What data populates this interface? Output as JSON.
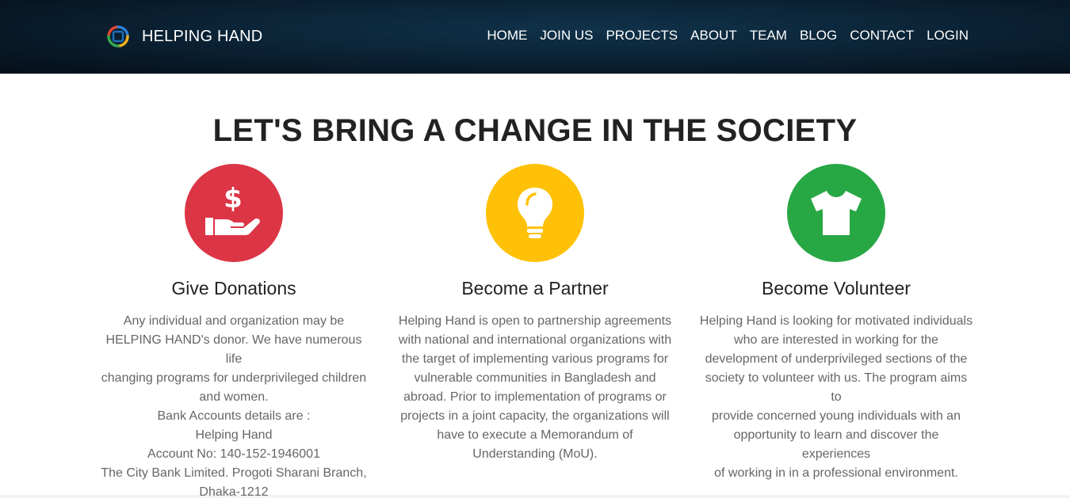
{
  "brand": {
    "name": "HELPING HAND",
    "logo_icon": "helping-hand-logo-icon"
  },
  "nav": {
    "items": [
      "HOME",
      "JOIN US",
      "PROJECTS",
      "ABOUT",
      "TEAM",
      "BLOG",
      "CONTACT",
      "LOGIN"
    ]
  },
  "hero": {
    "title": "LET'S BRING A CHANGE IN THE SOCIETY"
  },
  "cards": [
    {
      "title": "Give Donations",
      "icon": "donation-hand-icon",
      "color": "#dc3545",
      "lines": [
        "Any individual and organization may be",
        "HELPING HAND's donor. We have numerous life",
        "changing programs for underprivileged children",
        "and women.",
        "Bank Accounts details are :",
        "Helping Hand",
        "Account No: 140-152-1946001",
        "The City Bank Limited. Progoti Sharani Branch,",
        "Dhaka-1212"
      ]
    },
    {
      "title": "Become a Partner",
      "icon": "lightbulb-icon",
      "color": "#ffc107",
      "lines": [
        "Helping Hand is open to partnership agreements",
        "with national and international organizations with",
        "the target of implementing various programs for",
        "vulnerable communities in Bangladesh and",
        "abroad. Prior to implementation of programs or",
        "projects in a joint capacity, the organizations will",
        "have to execute a Memorandum of",
        "Understanding (MoU)."
      ]
    },
    {
      "title": "Become Volunteer",
      "icon": "tshirt-icon",
      "color": "#28a745",
      "lines": [
        "Helping Hand is looking for motivated individuals",
        "who are interested in working for the",
        "development of underprivileged sections of the",
        "society to volunteer with us. The program aims to",
        "provide concerned young individuals with an",
        "opportunity to learn and discover the experiences",
        "of working in in a professional environment."
      ]
    }
  ]
}
